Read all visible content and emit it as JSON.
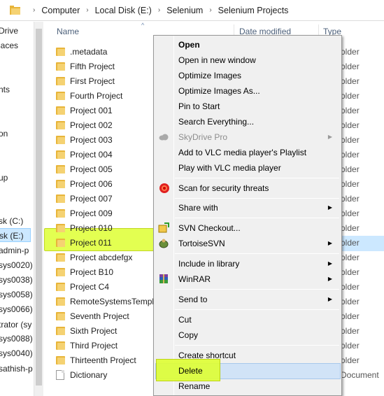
{
  "breadcrumb": [
    "Computer",
    "Local Disk (E:)",
    "Selenium",
    "Selenium Projects"
  ],
  "nav_pane": {
    "items": [
      "Drive",
      "laces",
      "nts",
      "on",
      "up",
      "sk (C:)",
      "sk (E:)",
      "admin-p",
      "sys0020)",
      "sys0038)",
      "sys0058)",
      "sys0066)",
      "trator (sy",
      "sys0088)",
      "sys0040)",
      "sathish-p"
    ]
  },
  "columns": {
    "name": "Name",
    "date_modified": "Date modified",
    "type": "Type"
  },
  "files": [
    ".metadata",
    "Fifth Project",
    "First Project",
    "Fourth Project",
    "Project 001",
    "Project 002",
    "Project 003",
    "Project 004",
    "Project 005",
    "Project 006",
    "Project 007",
    "Project 009",
    "Project 010",
    "Project 011",
    "Project abcdefgx",
    "Project B10",
    "Project C4",
    "RemoteSystemsTempl",
    "Seventh Project",
    "Sixth Project",
    "Third Project",
    "Thirteenth Project",
    "Dictionary"
  ],
  "type_col": [
    "older",
    "older",
    "older",
    "older",
    "older",
    "older",
    "older",
    "older",
    "older",
    "older",
    "older",
    "older",
    "older",
    "older",
    "older",
    "older",
    "older",
    "older",
    "older",
    "older",
    "older",
    "older",
    "Document"
  ],
  "context_menu": {
    "open": "Open",
    "open_new_window": "Open in new window",
    "optimize_images": "Optimize Images",
    "optimize_images_as": "Optimize Images As...",
    "pin_to_start": "Pin to Start",
    "search_everything": "Search Everything...",
    "skydrive_pro": "SkyDrive Pro",
    "add_vlc_playlist": "Add to VLC media player's Playlist",
    "play_vlc": "Play with VLC media player",
    "scan_threats": "Scan for security threats",
    "share_with": "Share with",
    "svn_checkout": "SVN Checkout...",
    "tortoise_svn": "TortoiseSVN",
    "include_library": "Include in library",
    "winrar": "WinRAR",
    "send_to": "Send to",
    "cut": "Cut",
    "copy": "Copy",
    "create_shortcut": "Create shortcut",
    "delete": "Delete",
    "rename": "Rename"
  },
  "highlight_color": "#dfff33",
  "selection_color": "#cce8ff"
}
